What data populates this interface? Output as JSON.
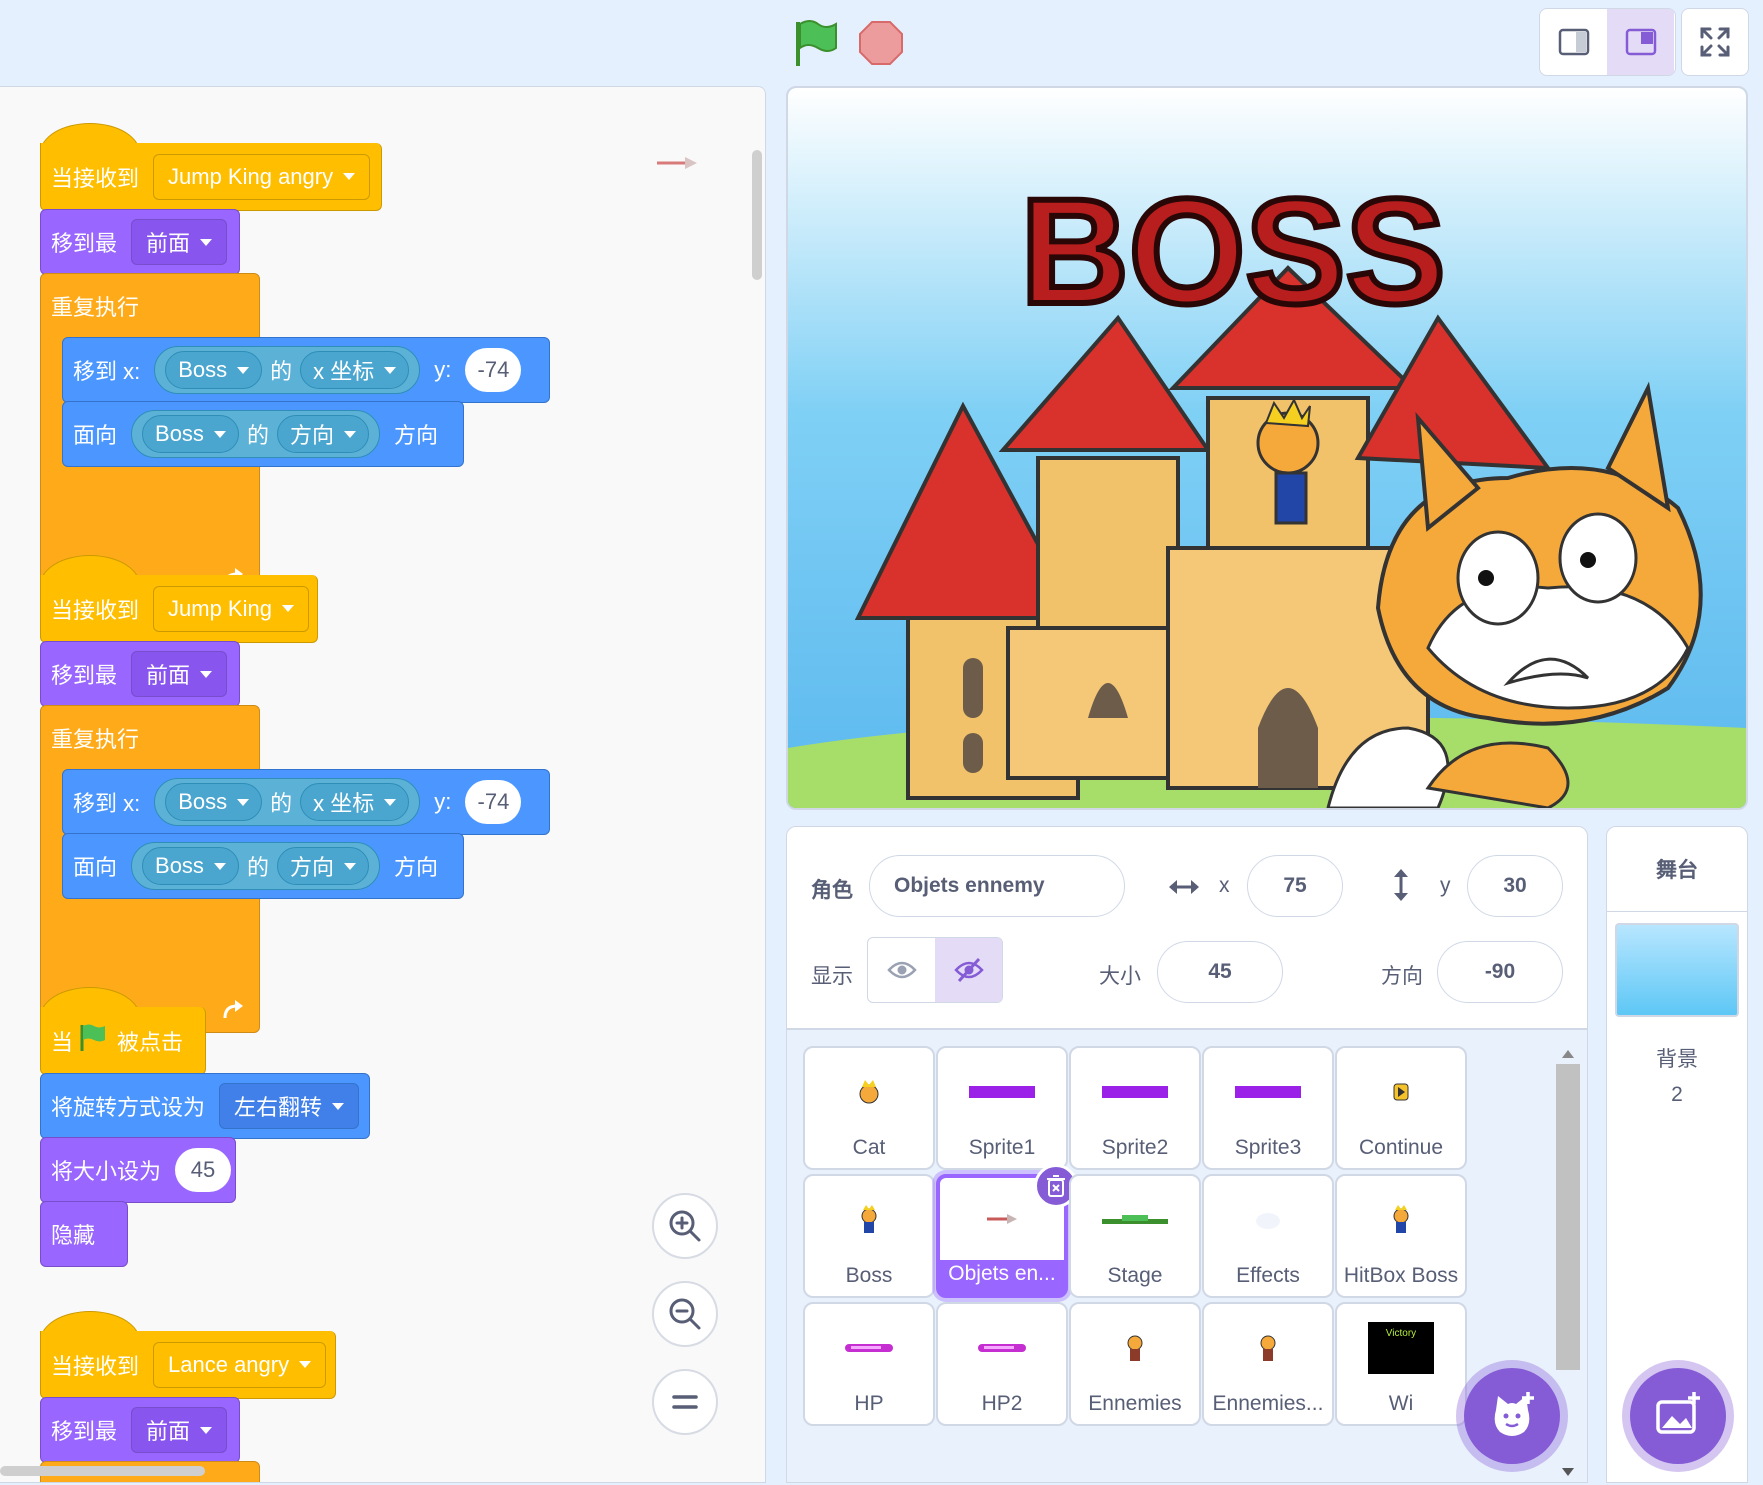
{
  "toolbar": {
    "green_flag_icon": "green-flag-icon",
    "stop_icon": "stop-icon",
    "small_stage_icon": "small-stage-icon",
    "normal_stage_icon": "normal-stage-icon",
    "fullscreen_icon": "fullscreen-icon"
  },
  "colors": {
    "events": "#ffbf00",
    "looks": "#9966ff",
    "control": "#ffab19",
    "motion": "#4c97ff",
    "sensing": "#5cb1d6",
    "selected": "#9966ff"
  },
  "scripts": [
    {
      "hat_label": "当接收到",
      "hat_message": "Jump King angry",
      "goto_front_label": "移到最",
      "goto_front_value": "前面",
      "forever_label": "重复执行",
      "goto_xy_label": "移到 x:",
      "goto_sprite": "Boss",
      "of_label": "的",
      "goto_prop": "x 坐标",
      "y_label": "y:",
      "y_value": "-74",
      "point_label": "面向",
      "point_sprite": "Boss",
      "point_of_label": "的",
      "point_prop": "方向",
      "point_suffix": "方向"
    },
    {
      "hat_label": "当接收到",
      "hat_message": "Jump King",
      "goto_front_label": "移到最",
      "goto_front_value": "前面",
      "forever_label": "重复执行",
      "goto_xy_label": "移到 x:",
      "goto_sprite": "Boss",
      "of_label": "的",
      "goto_prop": "x 坐标",
      "y_label": "y:",
      "y_value": "-74",
      "point_label": "面向",
      "point_sprite": "Boss",
      "point_of_label": "的",
      "point_prop": "方向",
      "point_suffix": "方向"
    }
  ],
  "flag_script": {
    "when_label": "当",
    "clicked_label": "被点击",
    "rotation_label": "将旋转方式设为",
    "rotation_value": "左右翻转",
    "size_label": "将大小设为",
    "size_value": "45",
    "hide_label": "隐藏"
  },
  "script4": {
    "hat_label": "当接收到",
    "hat_message": "Lance angry",
    "goto_front_label": "移到最",
    "goto_front_value": "前面"
  },
  "stage_text": "BOSS",
  "sprite_info": {
    "sprite_label": "角色",
    "sprite_name": "Objets ennemy",
    "x_label": "x",
    "x_value": "75",
    "y_label": "y",
    "y_value": "30",
    "show_label": "显示",
    "size_label": "大小",
    "size_value": "45",
    "direction_label": "方向",
    "direction_value": "-90"
  },
  "sprites": [
    {
      "name": "Cat",
      "icon": "cat-king-thumb"
    },
    {
      "name": "Sprite1",
      "icon": "purple-bar-thumb"
    },
    {
      "name": "Sprite2",
      "icon": "purple-bar-thumb"
    },
    {
      "name": "Sprite3",
      "icon": "purple-bar-thumb"
    },
    {
      "name": "Continue",
      "icon": "continue-thumb"
    },
    {
      "name": "Boss",
      "icon": "boss-thumb"
    },
    {
      "name": "Objets en...",
      "icon": "arrow-thumb",
      "selected": true
    },
    {
      "name": "Stage",
      "icon": "platform-thumb"
    },
    {
      "name": "Effects",
      "icon": "cloud-thumb"
    },
    {
      "name": "HitBox Boss",
      "icon": "boss-thumb"
    },
    {
      "name": "HP",
      "icon": "hp-bar-thumb"
    },
    {
      "name": "HP2",
      "icon": "hp-bar-thumb"
    },
    {
      "name": "Ennemies",
      "icon": "enemy-thumb"
    },
    {
      "name": "Ennemies...",
      "icon": "enemy-thumb"
    },
    {
      "name": "Wi",
      "icon": "victory-thumb"
    }
  ],
  "stage_panel": {
    "title": "舞台",
    "backdrops_label": "背景",
    "backdrops_count": "2"
  }
}
